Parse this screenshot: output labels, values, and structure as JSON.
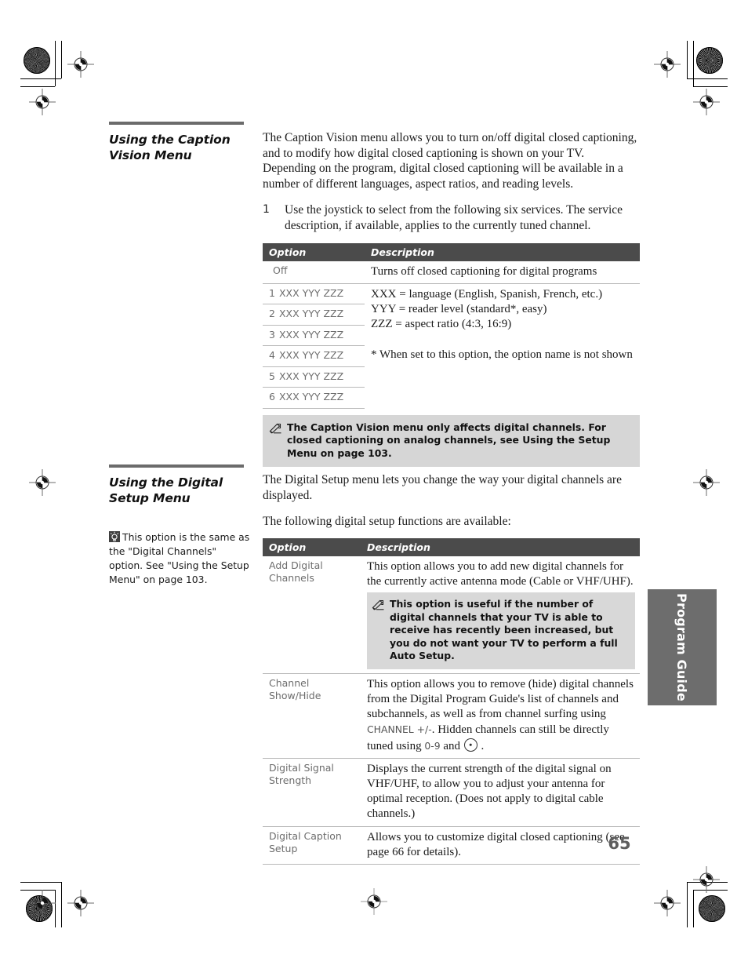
{
  "page": {
    "number": "65",
    "side_tab_label": "Program Guide"
  },
  "icons": {
    "pencil": "pencil-note-icon",
    "bulb": "lightbulb-tip-icon",
    "dot_button": "dot-button-icon",
    "registration": "registration-mark-icon",
    "densitometer": "densitometer-patch-icon",
    "crop": "crop-mark-icon"
  },
  "section1": {
    "title": "Using the Caption Vision Menu",
    "intro": "The Caption Vision menu allows you to turn on/off digital closed captioning, and to modify how digital closed captioning is shown on your TV. Depending on the program, digital closed captioning will be available in a number of different languages, aspect ratios, and reading levels.",
    "step_number": "1",
    "step_text": "Use the joystick to select from the following six services. The service description, if available, applies to the currently tuned channel.",
    "table": {
      "headers": [
        "Option",
        "Description"
      ],
      "rows": [
        {
          "num": "",
          "option": "Off",
          "desc": "Turns off closed captioning for digital programs"
        },
        {
          "num": "1",
          "option": "XXX YYY ZZZ",
          "desc": "XXX = language (English, Spanish, French, etc.)"
        },
        {
          "num": "2",
          "option": "XXX YYY ZZZ",
          "desc": "YYY = reader level (standard*, easy)"
        },
        {
          "num": "3",
          "option": "XXX YYY ZZZ",
          "desc": "ZZZ = aspect ratio (4:3, 16:9)"
        },
        {
          "num": "4",
          "option": "XXX YYY ZZZ",
          "desc": ""
        },
        {
          "num": "5",
          "option": "XXX YYY ZZZ",
          "desc": "* When set to this option, the option name is not shown"
        },
        {
          "num": "6",
          "option": "XXX YYY ZZZ",
          "desc": ""
        }
      ]
    },
    "note": "The Caption Vision menu only affects digital channels. For closed captioning on analog channels, see   Using the Setup Menu   on page 103."
  },
  "section2": {
    "title": "Using the Digital Setup Menu",
    "tip": "This option is the same as the \"Digital Channels\" option. See \"Using the Setup Menu\" on page 103.",
    "intro1": "The Digital Setup menu lets you change the way your digital channels are displayed.",
    "intro2": "The following digital setup functions are available:",
    "table": {
      "headers": [
        "Option",
        "Description"
      ],
      "rows": [
        {
          "option": "Add Digital Channels",
          "desc": "This option allows you to add new digital channels for the currently active antenna mode (Cable or VHF/UHF).",
          "note": "This option is useful if the number of digital channels that your TV is able to receive has recently been increased, but you do not want your TV to perform a full Auto Setup."
        },
        {
          "option": "Channel Show/Hide",
          "desc_part1": "This option allows you to remove (hide) digital channels from the Digital Program Guide's list of channels and subchannels, as well as from channel surfing using ",
          "keycap1": "CHANNEL +/-",
          "desc_part2": ". Hidden channels can still be directly tuned using ",
          "keycap2": "0-9",
          "desc_part3": " and ",
          "desc_part4": " ."
        },
        {
          "option": "Digital Signal Strength",
          "desc": "Displays the current strength of the digital signal on VHF/UHF, to allow you to adjust your antenna for optimal reception. (Does not apply to digital cable channels.)"
        },
        {
          "option": "Digital Caption Setup",
          "desc": "Allows you to customize digital closed captioning (see page 66 for details)."
        }
      ]
    }
  },
  "colors": {
    "table_header_bg": "#4b4b4b",
    "note_bg": "#d6d6d6",
    "side_tab_bg": "#6d6d6d",
    "rule": "#6b6b6b",
    "option_text": "#6d6d6d"
  }
}
